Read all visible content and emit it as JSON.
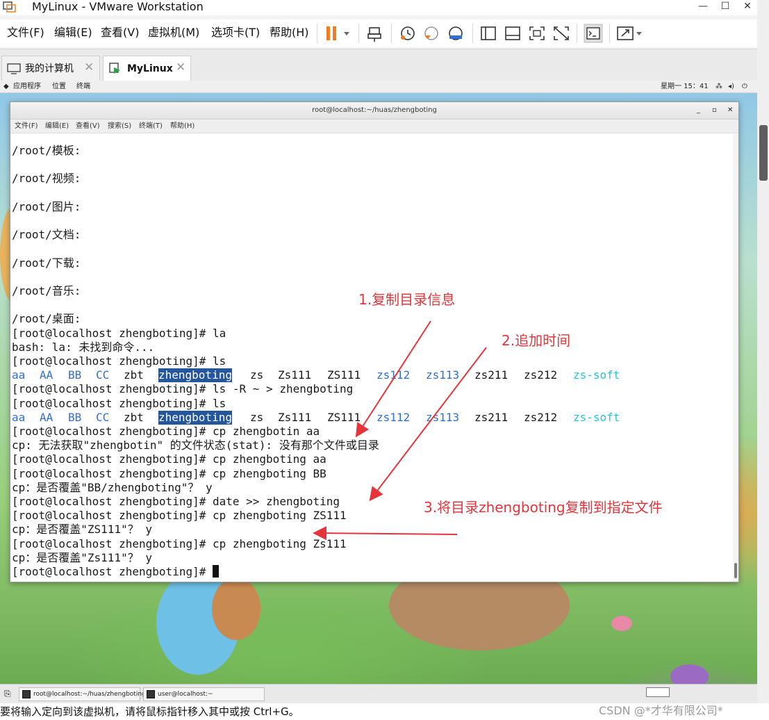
{
  "window": {
    "title": "MyLinux - VMware Workstation",
    "controls": {
      "minimize": "—",
      "maximize": "☐",
      "close": "✕"
    }
  },
  "menubar": {
    "items": [
      "文件(F)",
      "编辑(E)",
      "查看(V)",
      "虚拟机(M)",
      "选项卡(T)",
      "帮助(H)"
    ]
  },
  "toolbar": {
    "icons": [
      "pause-icon",
      "dropdown-icon",
      "send-keys-icon",
      "snapshot-take-icon",
      "snapshot-revert-icon",
      "snapshot-manager-icon",
      "full-panel-icon",
      "thumbnail-bar-icon",
      "unity-icon",
      "stretch-icon",
      "console-view-icon",
      "fullscreen-icon"
    ]
  },
  "tabs": [
    {
      "label": "我的计算机",
      "active": false
    },
    {
      "label": "MyLinux",
      "active": true
    }
  ],
  "guest_panel": {
    "left": [
      "应用程序",
      "位置",
      "终端"
    ],
    "clock": "星期一 15：41"
  },
  "terminal": {
    "title": "root@localhost:~/huas/zhengboting",
    "menus": [
      "文件(F)",
      "编辑(E)",
      "查看(V)",
      "搜索(S)",
      "终端(T)",
      "帮助(H)"
    ],
    "lines": [
      "/root/模板:",
      "",
      "/root/视频:",
      "",
      "/root/图片:",
      "",
      "/root/文档:",
      "",
      "/root/下载:",
      "",
      "/root/音乐:",
      "",
      "/root/桌面:",
      "[root@localhost zhengboting]# la",
      "bash: la: 未找到命令...",
      "[root@localhost zhengboting]# ls",
      "@LS1",
      "[root@localhost zhengboting]# ls -R ~ > zhengboting",
      "[root@localhost zhengboting]# ls",
      "@LS2",
      "[root@localhost zhengboting]# cp zhengbotin aa",
      "cp: 无法获取\"zhengbotin\" 的文件状态(stat): 没有那个文件或目录",
      "[root@localhost zhengboting]# cp zhengboting aa",
      "[root@localhost zhengboting]# cp zhengboting BB",
      "cp：是否覆盖\"BB/zhengboting\"？ y",
      "[root@localhost zhengboting]# date >> zhengboting",
      "[root@localhost zhengboting]# cp zhengboting ZS111",
      "cp：是否覆盖\"ZS111\"？ y",
      "[root@localhost zhengboting]# cp zhengboting Zs111",
      "cp：是否覆盖\"Zs111\"？ y",
      "[root@localhost zhengboting]# "
    ],
    "ls_output": [
      "aa",
      "AA",
      "BB",
      "CC",
      "zbt",
      "zhengboting",
      "zs",
      "Zs111",
      "ZS111",
      "zs112",
      "zs113",
      "zs211",
      "zs212",
      "zs-soft"
    ],
    "ls_colors": {
      "aa": "blue",
      "AA": "blue",
      "BB": "blue",
      "CC": "blue",
      "zbt": "plain",
      "zhengboting": "highlight",
      "zs": "plain",
      "Zs111": "plain",
      "ZS111": "plain",
      "zs112": "blue",
      "zs113": "blue",
      "zs211": "plain",
      "zs212": "plain",
      "zs-soft": "cyan"
    }
  },
  "annotations": [
    {
      "text": "1.复制目录信息"
    },
    {
      "text": "2.追加时间"
    },
    {
      "text": "3.将目录zhengboting复制到指定文件"
    }
  ],
  "taskbar": {
    "items": [
      "root@localhost:~/huas/zhengboting",
      "user@localhost:~"
    ]
  },
  "statusbar": {
    "text": "要将输入定向到该虚拟机，请将鼠标指针移入其中或按 Ctrl+G。",
    "watermark": "CSDN @*才华有限公司*"
  },
  "colors": {
    "annotation": "#e5343a",
    "ls_blue": "#2f6fd6",
    "ls_cyan": "#21c6d8",
    "ls_highlight_bg": "#24569e",
    "pause_orange": "#f07c22"
  }
}
